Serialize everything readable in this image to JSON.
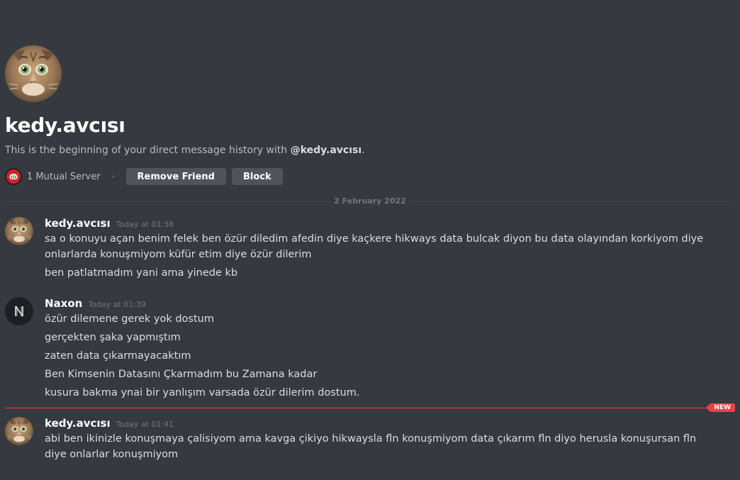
{
  "profile": {
    "username": "kedy.avcısı",
    "intro_prefix": "This is the beginning of your direct message history with ",
    "intro_handle": "@kedy.avcısı",
    "intro_suffix": ".",
    "mutual_servers": "1 Mutual Server",
    "remove_friend_label": "Remove Friend",
    "block_label": "Block"
  },
  "date_divider": "2 February 2022",
  "new_label": "NEW",
  "messages": [
    {
      "author": "kedy.avcısı",
      "time": "Today at 01:38",
      "lines": [
        "sa o konuyu açan benim felek ben özür diledim afedin diye kaçkere hikways data bulcak diyon bu data olayından korkiyom diye onlarlarda konuşmiyom küfür etim diye özür dilerim",
        "ben patlatmadım yani ama yinede kb"
      ]
    },
    {
      "author": "Naxon",
      "time": "Today at 01:39",
      "lines": [
        "özür dilemene gerek yok dostum",
        "gerçekten şaka yapmıştım",
        "zaten data çıkarmayacaktım",
        "Ben Kimsenin Datasını Çkarmadım bu Zamana kadar",
        "kusura bakma ynai bir yanlışım varsada özür dilerim dostum."
      ]
    },
    {
      "author": "kedy.avcısı",
      "time": "Today at 01:41",
      "lines": [
        "abi  ben ikinizle konuşmaya çalisiyom ama kavga çikiyo hikwaysla fln konuşmiyom data çıkarım fln diyo  herusla konuşursan fln diye onlarlar konuşmiyom"
      ]
    }
  ],
  "colors": {
    "background": "#36393f",
    "button": "#4f545c",
    "new_marker": "#ed4245",
    "text": "#dcddde",
    "muted": "#b9bbbe"
  }
}
